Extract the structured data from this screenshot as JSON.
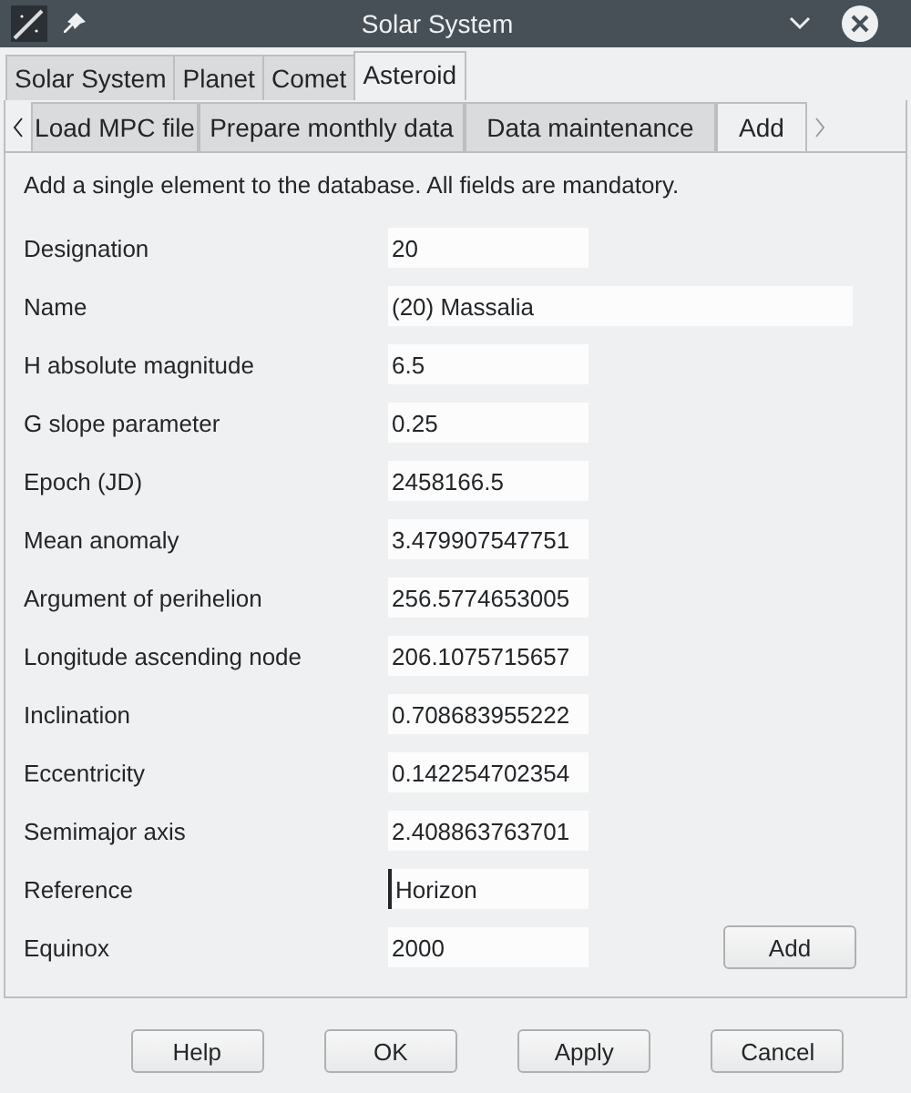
{
  "window": {
    "title": "Solar System"
  },
  "tabs": [
    {
      "label": "Solar System",
      "selected": false
    },
    {
      "label": "Planet",
      "selected": false
    },
    {
      "label": "Comet",
      "selected": false
    },
    {
      "label": "Asteroid",
      "selected": true
    }
  ],
  "subtabs": [
    {
      "label": "Load MPC file",
      "selected": false
    },
    {
      "label": "Prepare monthly data",
      "selected": false
    },
    {
      "label": "Data maintenance",
      "selected": false
    },
    {
      "label": "Add",
      "selected": true
    }
  ],
  "description": "Add a single element to the database. All fields are mandatory.",
  "fields": [
    {
      "label": "Designation",
      "value": "20",
      "wide": false,
      "focused": false
    },
    {
      "label": "Name",
      "value": "(20) Massalia",
      "wide": true,
      "focused": false
    },
    {
      "label": "H absolute magnitude",
      "value": "6.5",
      "wide": false,
      "focused": false
    },
    {
      "label": "G slope parameter",
      "value": "0.25",
      "wide": false,
      "focused": false
    },
    {
      "label": "Epoch (JD)",
      "value": "2458166.5",
      "wide": false,
      "focused": false
    },
    {
      "label": "Mean anomaly",
      "value": "3.479907547751",
      "wide": false,
      "focused": false
    },
    {
      "label": "Argument of perihelion",
      "value": "256.5774653005",
      "wide": false,
      "focused": false
    },
    {
      "label": "Longitude ascending node",
      "value": "206.1075715657",
      "wide": false,
      "focused": false
    },
    {
      "label": "Inclination",
      "value": "0.708683955222",
      "wide": false,
      "focused": false
    },
    {
      "label": "Eccentricity",
      "value": "0.142254702354",
      "wide": false,
      "focused": false
    },
    {
      "label": "Semimajor axis",
      "value": "2.408863763701",
      "wide": false,
      "focused": false
    },
    {
      "label": "Reference",
      "value": "Horizon",
      "wide": false,
      "focused": true
    },
    {
      "label": "Equinox",
      "value": "2000",
      "wide": false,
      "focused": false
    }
  ],
  "add_button": "Add",
  "buttons": [
    "Help",
    "OK",
    "Apply",
    "Cancel"
  ]
}
